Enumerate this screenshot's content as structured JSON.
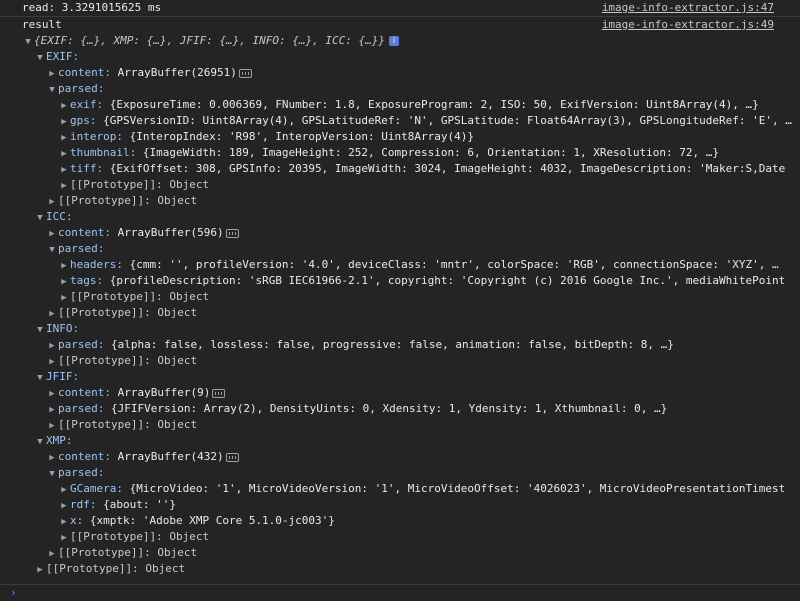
{
  "messages": {
    "read": {
      "text": "read: 3.3291015625 ms",
      "source": "image-info-extractor.js:47"
    },
    "result": {
      "text": "result",
      "source": "image-info-extractor.js:49"
    }
  },
  "root_summary": "{EXIF: {…}, XMP: {…}, JFIF: {…}, INFO: {…}, ICC: {…}}",
  "info_badge": "i",
  "tree": {
    "exif": {
      "label": "EXIF:",
      "content_key": "content:",
      "content_val": "ArrayBuffer(26951)",
      "parsed_key": "parsed:",
      "exif_key": "exif:",
      "exif_val": "{ExposureTime: 0.006369, FNumber: 1.8, ExposureProgram: 2, ISO: 50, ExifVersion: Uint8Array(4), …}",
      "gps_key": "gps:",
      "gps_val": "{GPSVersionID: Uint8Array(4), GPSLatitudeRef: 'N', GPSLatitude: Float64Array(3), GPSLongitudeRef: 'E', …",
      "interop_key": "interop:",
      "interop_val": "{InteropIndex: 'R98', InteropVersion: Uint8Array(4)}",
      "thumbnail_key": "thumbnail:",
      "thumbnail_val": "{ImageWidth: 189, ImageHeight: 252, Compression: 6, Orientation: 1, XResolution: 72, …}",
      "tiff_key": "tiff:",
      "tiff_val": "{ExifOffset: 308, GPSInfo: 20395, ImageWidth: 3024, ImageHeight: 4032, ImageDescription: 'Maker:S,Date",
      "proto_inner": "[[Prototype]]: Object",
      "proto_outer": "[[Prototype]]: Object"
    },
    "icc": {
      "label": "ICC:",
      "content_key": "content:",
      "content_val": "ArrayBuffer(596)",
      "parsed_key": "parsed:",
      "headers_key": "headers:",
      "headers_val": "{cmm: '', profileVersion: '4.0', deviceClass: 'mntr', colorSpace: 'RGB', connectionSpace: 'XYZ', …",
      "tags_key": "tags:",
      "tags_val": "{profileDescription: 'sRGB IEC61966-2.1', copyright: 'Copyright (c) 2016 Google Inc.', mediaWhitePoint",
      "proto_inner": "[[Prototype]]: Object",
      "proto_outer": "[[Prototype]]: Object"
    },
    "info": {
      "label": "INFO:",
      "parsed_key": "parsed:",
      "parsed_val": "{alpha: false, lossless: false, progressive: false, animation: false, bitDepth: 8, …}",
      "proto": "[[Prototype]]: Object"
    },
    "jfif": {
      "label": "JFIF:",
      "content_key": "content:",
      "content_val": "ArrayBuffer(9)",
      "parsed_key": "parsed:",
      "parsed_val": "{JFIFVersion: Array(2), DensityUints: 0, Xdensity: 1, Ydensity: 1, Xthumbnail: 0, …}",
      "proto": "[[Prototype]]: Object"
    },
    "xmp": {
      "label": "XMP:",
      "content_key": "content:",
      "content_val": "ArrayBuffer(432)",
      "parsed_key": "parsed:",
      "gcamera_key": "GCamera:",
      "gcamera_val": "{MicroVideo: '1', MicroVideoVersion: '1', MicroVideoOffset: '4026023', MicroVideoPresentationTimest",
      "rdf_key": "rdf:",
      "rdf_val": "{about: ''}",
      "x_key": "x:",
      "x_val": "{xmptk: 'Adobe XMP Core 5.1.0-jc003'}",
      "proto_inner": "[[Prototype]]: Object",
      "proto_outer": "[[Prototype]]: Object"
    },
    "root_proto": "[[Prototype]]: Object"
  },
  "prompt_glyph": "›",
  "colors": {
    "background": "#242424",
    "key": "#9fc3f0",
    "number": "#9980ff",
    "string": "#f28b82",
    "link": "#c7c7c7"
  }
}
